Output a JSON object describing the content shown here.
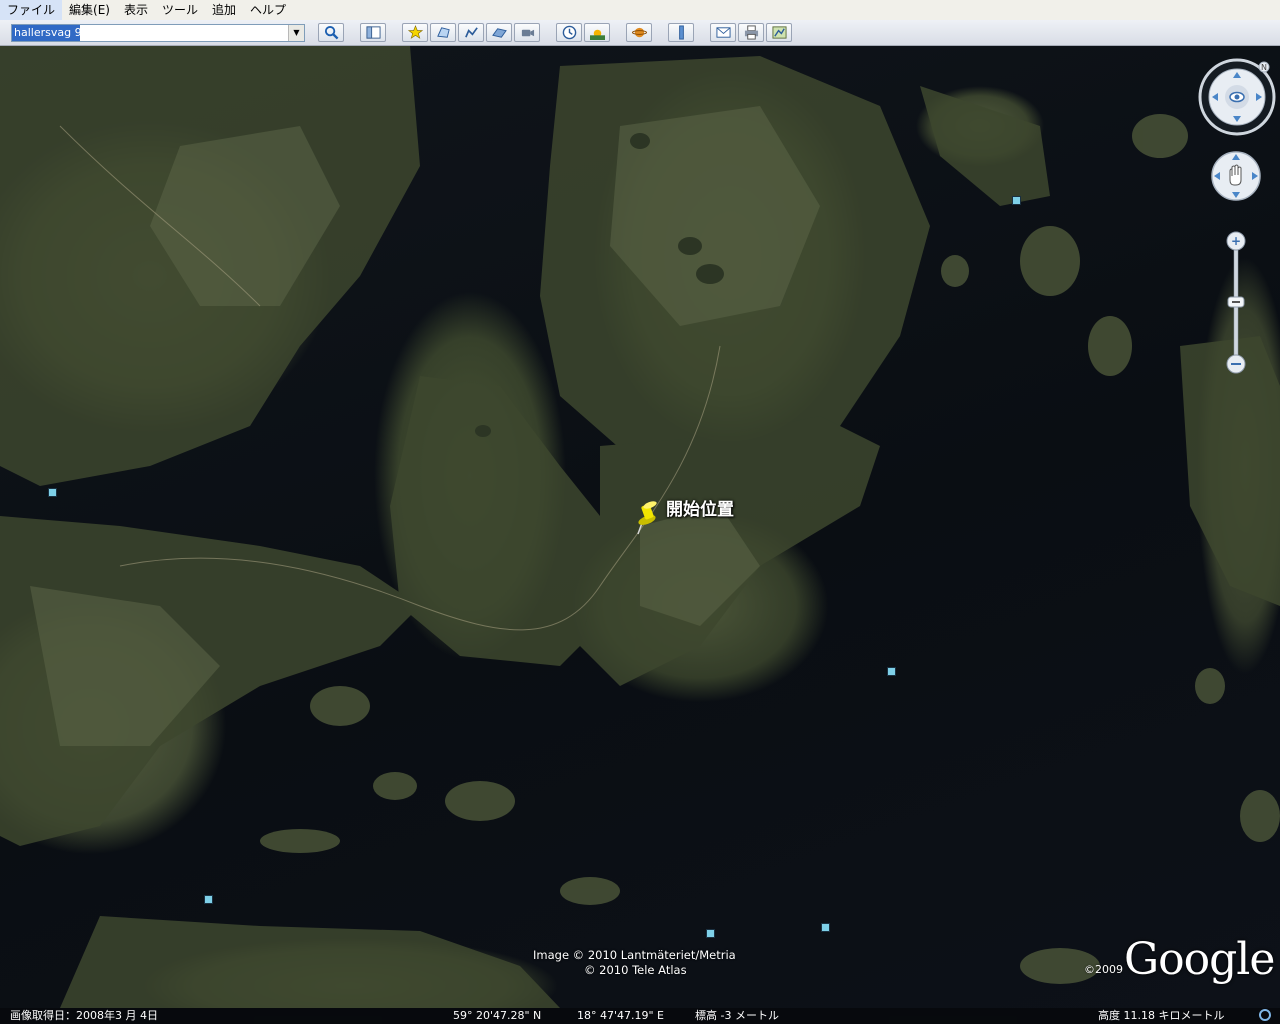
{
  "menu": {
    "items": [
      "ファイル",
      "編集(E)",
      "表示",
      "ツール",
      "追加",
      "ヘルプ"
    ]
  },
  "search": {
    "value": "hallersvag 9"
  },
  "toolbar": {
    "icons": [
      "sidebar-icon",
      "placemark-icon",
      "polygon-icon",
      "path-icon",
      "image-overlay-icon",
      "record-tour-icon",
      "historical-imagery-icon",
      "sunlight-icon",
      "planets-icon",
      "ruler-icon",
      "email-icon",
      "print-icon",
      "view-in-maps-icon"
    ]
  },
  "map": {
    "placemark_label": "開始位置",
    "attribution_line1": "Image © 2010 Lantmäteriet/Metria",
    "attribution_line2": "© 2010 Tele Atlas",
    "copyright_year": "©2009",
    "logo_text": "Google"
  },
  "status": {
    "imagery_date": "画像取得日：2008年3 月 4日",
    "latitude": "59° 20'47.28\" N",
    "longitude": "18° 47'47.19\" E",
    "elevation": "標高  -3 メートル",
    "eye_altitude": "高度    11.18 キロメートル"
  },
  "colors": {
    "water": "#0b0f14",
    "land": "#4a5535",
    "selection": "#316ac5",
    "placemark": "#f2e600"
  }
}
